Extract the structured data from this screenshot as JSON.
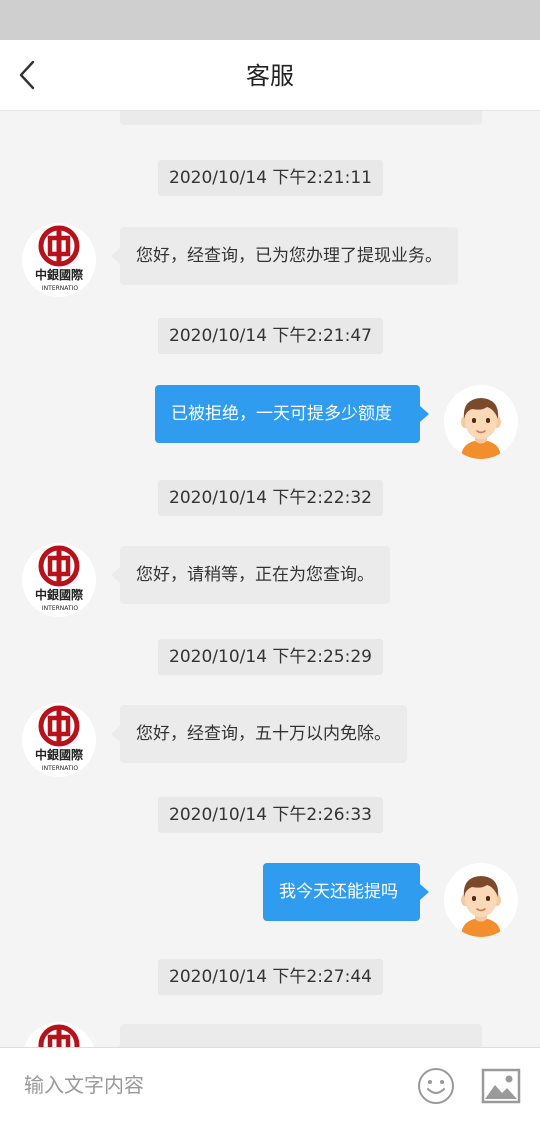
{
  "header": {
    "title": "客服",
    "back_icon": "chevron-left-icon"
  },
  "messages": [
    {
      "type": "timestamp",
      "text": "2020/10/14 下午2:21:11"
    },
    {
      "type": "incoming",
      "sender": "bank",
      "text": "您好，经查询，已为您办理了提现业务。"
    },
    {
      "type": "timestamp",
      "text": "2020/10/14 下午2:21:47"
    },
    {
      "type": "outgoing",
      "sender": "user",
      "text": "已被拒绝，一天可提多少额度"
    },
    {
      "type": "timestamp",
      "text": "2020/10/14 下午2:22:32"
    },
    {
      "type": "incoming",
      "sender": "bank",
      "text": "您好，请稍等，正在为您查询。"
    },
    {
      "type": "timestamp",
      "text": "2020/10/14 下午2:25:29"
    },
    {
      "type": "incoming",
      "sender": "bank",
      "text": "您好，经查询，五十万以内免除。"
    },
    {
      "type": "timestamp",
      "text": "2020/10/14 下午2:26:33"
    },
    {
      "type": "outgoing",
      "sender": "user",
      "text": "我今天还能提吗"
    },
    {
      "type": "timestamp",
      "text": "2020/10/14 下午2:27:44"
    }
  ],
  "bank_avatar": {
    "text": "中銀國際",
    "sub": "INTERNATIO",
    "color": "#b5121b"
  },
  "input": {
    "placeholder": "输入文字内容",
    "emoji_icon": "emoji-icon",
    "image_icon": "image-icon"
  },
  "colors": {
    "accent": "#2f9cf0",
    "bank_red": "#b5121b"
  }
}
